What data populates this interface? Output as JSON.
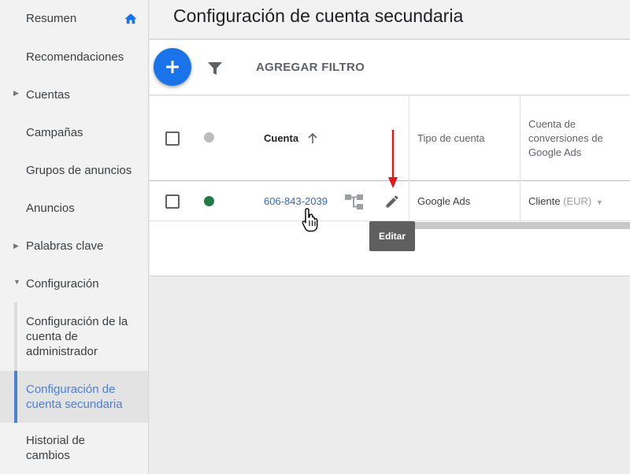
{
  "sidebar": {
    "items": [
      {
        "label": "Resumen"
      },
      {
        "label": "Recomendaciones"
      },
      {
        "label": "Cuentas"
      },
      {
        "label": "Campañas"
      },
      {
        "label": "Grupos de anuncios"
      },
      {
        "label": "Anuncios"
      },
      {
        "label": "Palabras clave"
      },
      {
        "label": "Configuración"
      },
      {
        "label": "Configuración de la cuenta de administrador"
      },
      {
        "label": "Configuración de cuenta secundaria"
      },
      {
        "label": "Historial de cambios"
      }
    ]
  },
  "header": {
    "title": "Configuración de cuenta secundaria"
  },
  "toolbar": {
    "add_filter": "AGREGAR FILTRO"
  },
  "table": {
    "columns": {
      "account": "Cuenta",
      "account_type": "Tipo de cuenta",
      "conversion_account": "Cuenta de conversiones de Google Ads"
    },
    "row": {
      "account_id": "606-843-2039",
      "account_type": "Google Ads",
      "conversion_account": "Cliente",
      "currency": "(EUR)",
      "status_color": "#1e7b4a"
    }
  },
  "tooltip": {
    "label": "Editar"
  },
  "colors": {
    "accent": "#1a73e8",
    "annotation_arrow": "#e0161b"
  }
}
